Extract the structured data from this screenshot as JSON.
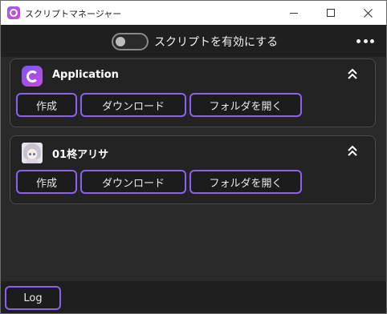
{
  "window": {
    "title": "スクリプトマネージャー"
  },
  "header": {
    "toggle_label": "スクリプトを有効にする",
    "toggle_on": false
  },
  "cards": [
    {
      "title": "Application",
      "icon": "app-logo-icon",
      "buttons": {
        "create": "作成",
        "download": "ダウンロード",
        "open_folder": "フォルダを開く"
      }
    },
    {
      "title": "01柊アリサ",
      "icon": "avatar-thumbnail",
      "buttons": {
        "create": "作成",
        "download": "ダウンロード",
        "open_folder": "フォルダを開く"
      }
    }
  ],
  "footer": {
    "log_label": "Log"
  },
  "colors": {
    "accent": "#8b62f0",
    "background": "#2a2a2a",
    "card": "#232323"
  }
}
